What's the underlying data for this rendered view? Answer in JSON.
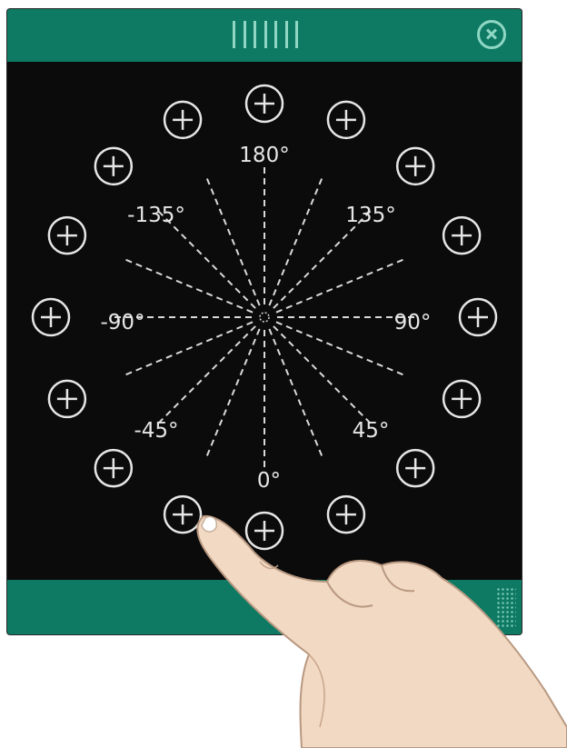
{
  "colors": {
    "accent": "#0e7a63",
    "accent_light": "#8fd7c4",
    "panel_bg": "#0b0b0b"
  },
  "icons": {
    "close": "close-icon",
    "position_button": "plus-circle-icon"
  },
  "angle_labels": [
    "180°",
    "135°",
    "90°",
    "45°",
    "0°",
    "-45°",
    "-90°",
    "-135°"
  ]
}
